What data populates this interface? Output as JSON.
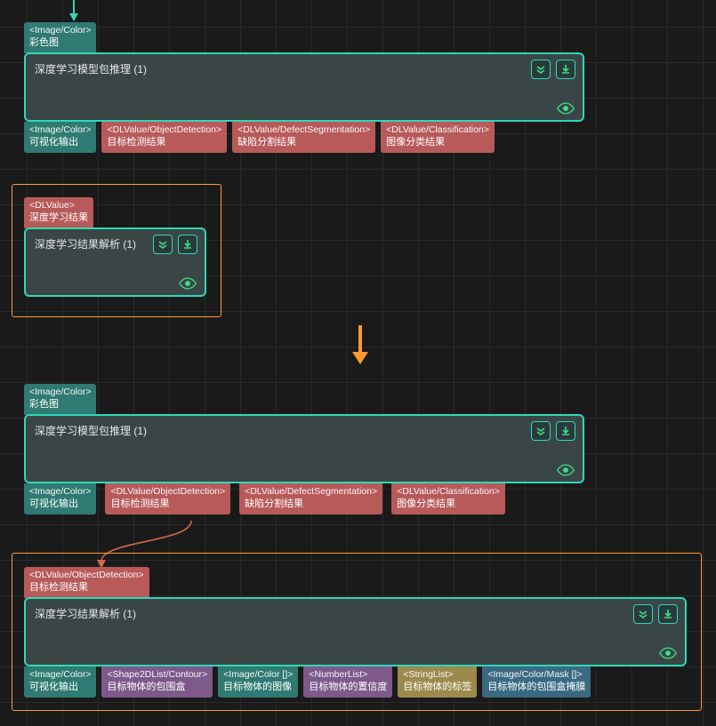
{
  "nodes": {
    "n1": {
      "title": "深度学习模型包推理 (1)",
      "in": {
        "type": "<Image/Color>",
        "label": "彩色图"
      },
      "out1": {
        "type": "<Image/Color>",
        "label": "可视化输出"
      },
      "out2": {
        "type": "<DLValue/ObjectDetection>",
        "label": "目标检测结果"
      },
      "out3": {
        "type": "<DLValue/DefectSegmentation>",
        "label": "缺陷分割结果"
      },
      "out4": {
        "type": "<DLValue/Classification>",
        "label": "图像分类结果"
      }
    },
    "n2": {
      "title": "深度学习结果解析 (1)",
      "in": {
        "type": "<DLValue>",
        "label": "深度学习结果"
      }
    },
    "n3": {
      "title": "深度学习模型包推理 (1)",
      "in": {
        "type": "<Image/Color>",
        "label": "彩色图"
      },
      "out1": {
        "type": "<Image/Color>",
        "label": "可视化输出"
      },
      "out2": {
        "type": "<DLValue/ObjectDetection>",
        "label": "目标检测结果"
      },
      "out3": {
        "type": "<DLValue/DefectSegmentation>",
        "label": "缺陷分割结果"
      },
      "out4": {
        "type": "<DLValue/Classification>",
        "label": "图像分类结果"
      }
    },
    "n4": {
      "title": "深度学习结果解析 (1)",
      "in": {
        "type": "<DLValue/ObjectDetection>",
        "label": "目标检测结果"
      },
      "out1": {
        "type": "<Image/Color>",
        "label": "可视化输出"
      },
      "out2": {
        "type": "<Shape2DList/Contour>",
        "label": "目标物体的包围盒"
      },
      "out3": {
        "type": "<Image/Color []>",
        "label": "目标物体的图像"
      },
      "out4": {
        "type": "<NumberList>",
        "label": "目标物体的置信度"
      },
      "out5": {
        "type": "<StringList>",
        "label": "目标物体的标签"
      },
      "out6": {
        "type": "<Image/Color/Mask []>",
        "label": "目标物体的包围盒掩膜"
      }
    }
  }
}
